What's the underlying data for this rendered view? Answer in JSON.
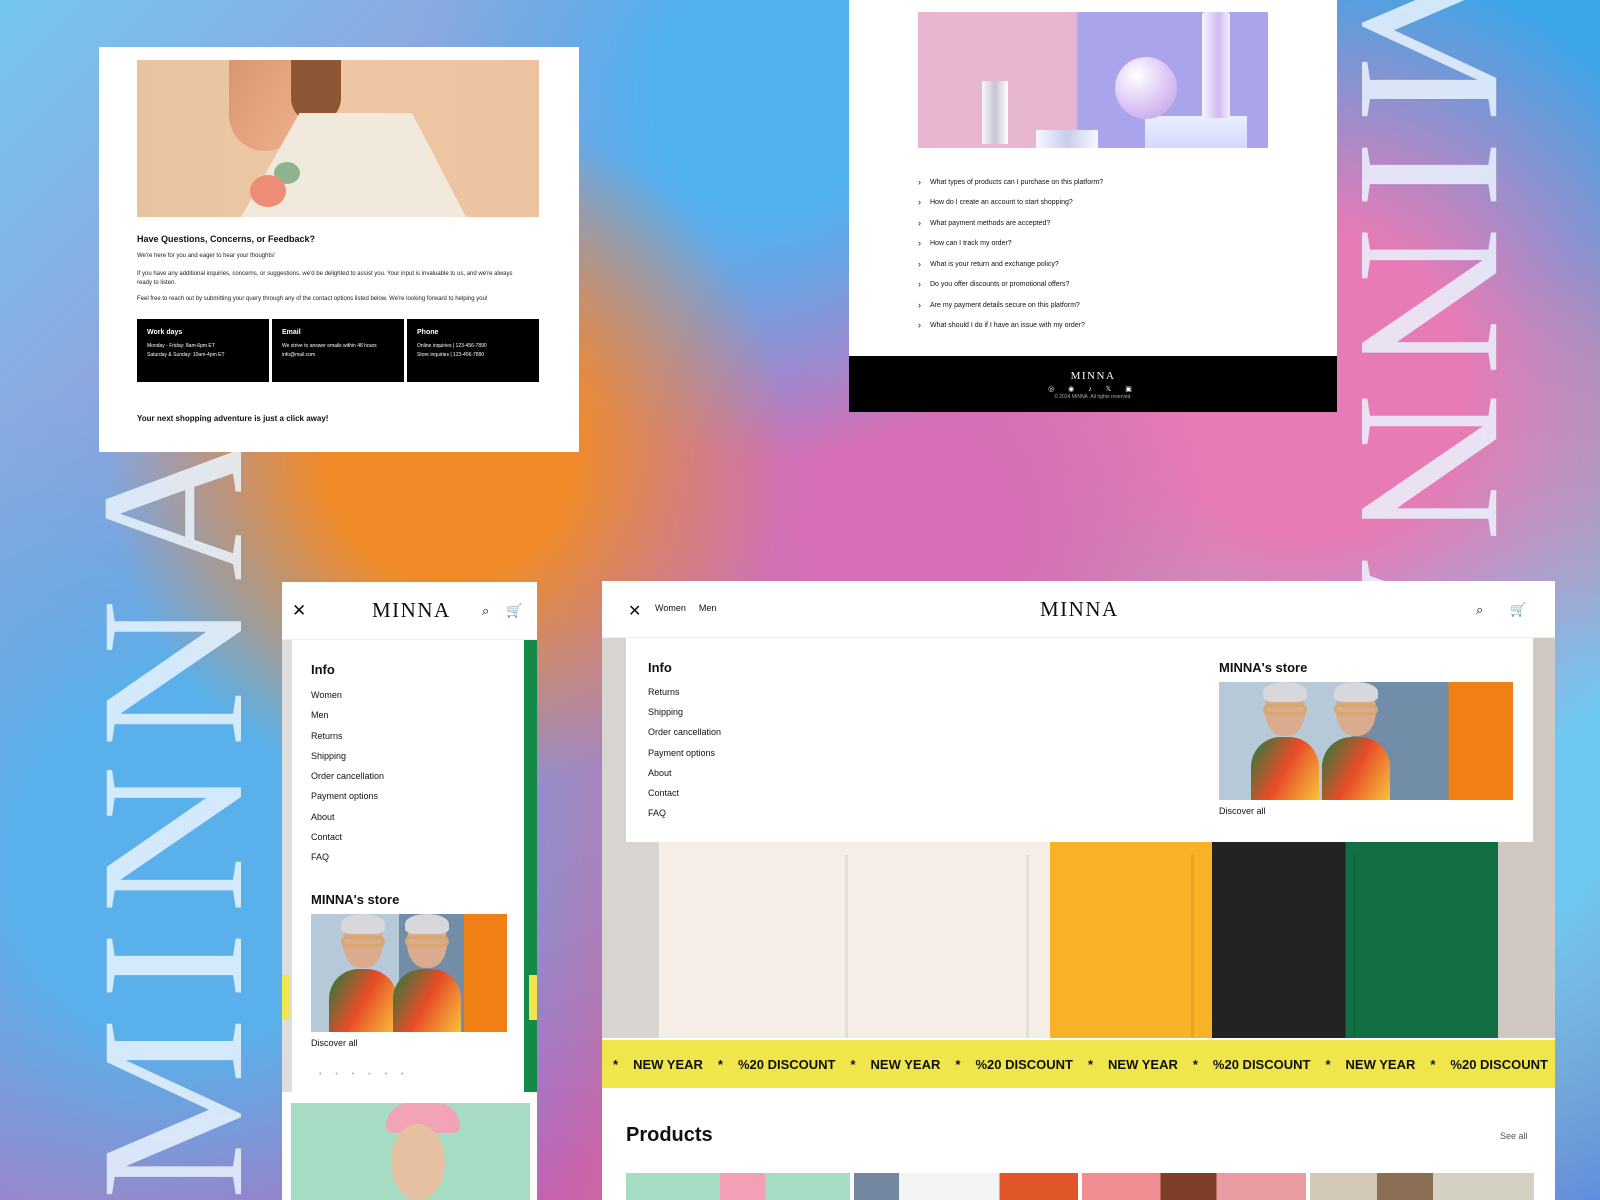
{
  "brand": {
    "decor_left": "MINNA",
    "decor_right": "MINNA"
  },
  "contact": {
    "title": "Have Questions, Concerns, or Feedback?",
    "copy_a": "We're here for you and eager to hear your thoughts!",
    "copy_b": "If you have any additional inquiries, concerns, or suggestions, we'd be delighted to assist you. Your input is invaluable to us, and we're always ready to listen.",
    "copy_c": "Feel free to reach out by submitting your query through any of the contact options listed below. We're looking forward to helping you!",
    "boxes": [
      {
        "title": "Work days",
        "line1": "Monday - Friday: 8am-6pm ET",
        "line2": "Saturday & Sunday: 10am-4pm ET"
      },
      {
        "title": "Email",
        "line1": "We strive to answer emails within 48 hours",
        "line2": "info@mail.com"
      },
      {
        "title": "Phone",
        "line1": "Online inquiries | 123-456-7890",
        "line2": "Store inquiries | 123-456-7890"
      }
    ],
    "footer": "Your next shopping adventure is just a click away!"
  },
  "faq": {
    "items": [
      "What types of products can I purchase on this platform?",
      "How do I create an account to start shopping?",
      "What payment methods are accepted?",
      "How can I track my order?",
      "What is your return and exchange policy?",
      "Do you offer discounts or promotional offers?",
      "Are my payment details secure on this platform?",
      "What should I do if I have an issue with my order?"
    ],
    "footer_logo": "MINNA",
    "footer_icons": "◎ ◉ ♪ 𝕏 ▣",
    "footer_copy": "© 2024 MINNA. All rights reserved."
  },
  "mobile": {
    "logo": "MINNA",
    "close_icon": "✕",
    "search_icon": "⌕",
    "cart_icon": "🛒",
    "info_heading": "Info",
    "menu_items": [
      "Women",
      "Men",
      "Returns",
      "Shipping",
      "Order cancellation",
      "Payment options",
      "About",
      "Contact",
      "FAQ"
    ],
    "store_title": "MINNA's store",
    "discover": "Discover all",
    "pager": "• • • • • •"
  },
  "desktop": {
    "close_icon": "✕",
    "nav": [
      "Women",
      "Men"
    ],
    "logo": "MINNA",
    "search_icon": "⌕",
    "cart_icon": "🛒",
    "info_heading": "Info",
    "menu_items": [
      "Returns",
      "Shipping",
      "Order cancellation",
      "Payment options",
      "About",
      "Contact",
      "FAQ"
    ],
    "store_title": "MINNA's store",
    "discover": "Discover all",
    "ticker_star": "*",
    "ticker_items": [
      "NEW YEAR",
      "%20 DISCOUNT",
      "NEW YEAR",
      "%20 DISCOUNT",
      "NEW YEAR",
      "%20 DISCOUNT",
      "NEW YEAR",
      "%20 DISCOUNT"
    ],
    "products_title": "Products",
    "see_all": "See all"
  }
}
